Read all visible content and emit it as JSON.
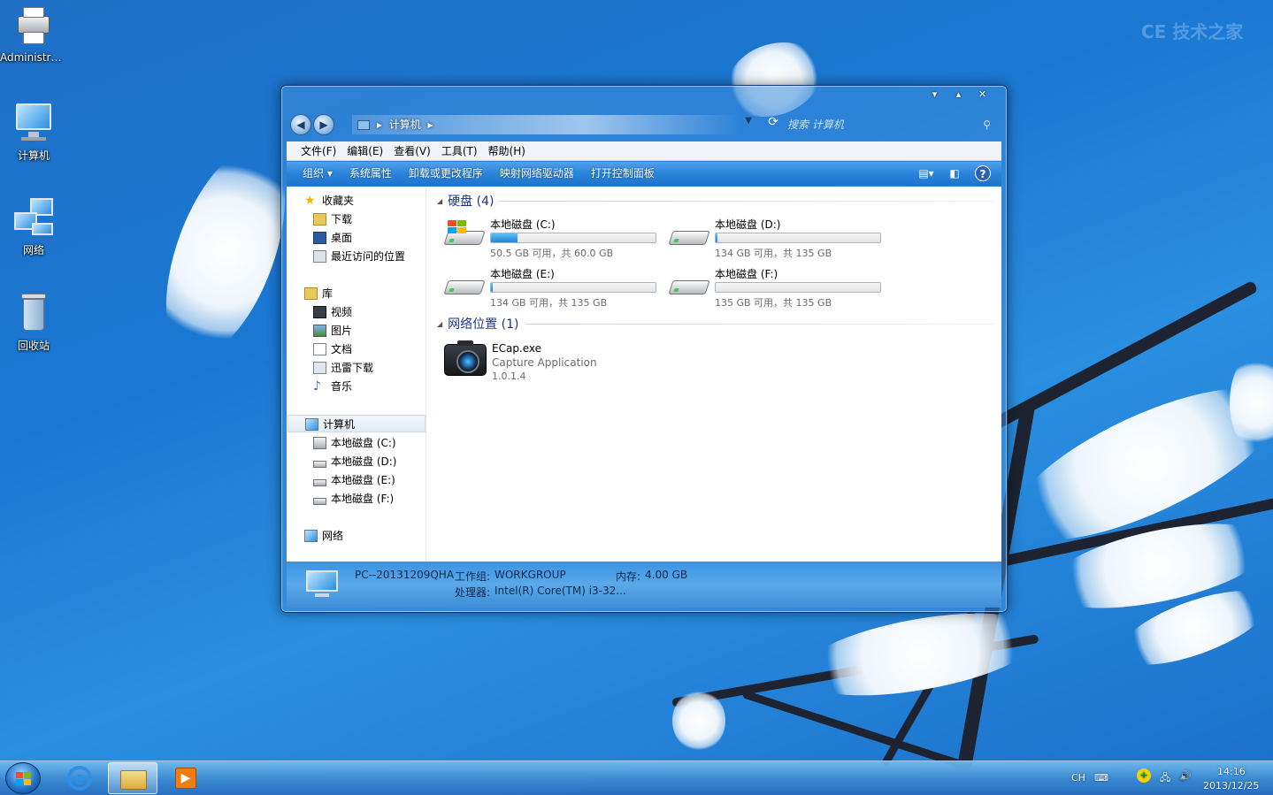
{
  "desktop": {
    "icons": [
      {
        "label": "Administra...",
        "icon": "printer-icon"
      },
      {
        "label": "计算机",
        "icon": "computer-icon"
      },
      {
        "label": "网络",
        "icon": "network-icon"
      },
      {
        "label": "回收站",
        "icon": "recycle-bin-icon"
      }
    ]
  },
  "window": {
    "controls": {
      "minimize": "▾",
      "maximize": "▴",
      "close": "✕"
    },
    "nav": {
      "back": "◀",
      "forward": "▶"
    },
    "address": {
      "path_item": "计算机",
      "separator": "▸"
    },
    "search": {
      "placeholder": "搜索 计算机",
      "icon": "⚲"
    },
    "menu": [
      "文件(F)",
      "编辑(E)",
      "查看(V)",
      "工具(T)",
      "帮助(H)"
    ],
    "toolbar": {
      "organize": "组织 ▾",
      "system_properties": "系统属性",
      "uninstall": "卸载或更改程序",
      "map_drive": "映射网络驱动器",
      "control_panel": "打开控制面板",
      "help": "?"
    },
    "nav_pane": {
      "favorites": "收藏夹",
      "downloads": "下载",
      "desktop": "桌面",
      "recent": "最近访问的位置",
      "libraries": "库",
      "videos": "视频",
      "pictures": "图片",
      "documents": "文档",
      "thunder": "迅雷下载",
      "music": "音乐",
      "computer": "计算机",
      "drive_c": "本地磁盘 (C:)",
      "drive_d": "本地磁盘 (D:)",
      "drive_e": "本地磁盘 (E:)",
      "drive_f": "本地磁盘 (F:)",
      "network": "网络"
    },
    "groups": {
      "hdd": "硬盘 (4)",
      "network": "网络位置 (1)"
    },
    "drives": [
      {
        "name": "本地磁盘 (C:)",
        "info": "50.5 GB 可用，共 60.0 GB",
        "used_fraction": 0.16
      },
      {
        "name": "本地磁盘 (D:)",
        "info": "134 GB 可用，共 135 GB",
        "used_fraction": 0.01
      },
      {
        "name": "本地磁盘 (E:)",
        "info": "134 GB 可用，共 135 GB",
        "used_fraction": 0.01
      },
      {
        "name": "本地磁盘 (F:)",
        "info": "135 GB 可用，共 135 GB",
        "used_fraction": 0.0
      }
    ],
    "network_item": {
      "name": "ECap.exe",
      "description": "Capture Application",
      "version": "1.0.1.4"
    },
    "details": {
      "pc_name": "PC--20131209QHA",
      "workgroup_label": "工作组:",
      "workgroup": "WORKGROUP",
      "memory_label": "内存:",
      "memory": "4.00 GB",
      "cpu_label": "处理器:",
      "cpu": "Intel(R) Core(TM) i3-32..."
    }
  },
  "taskbar": {
    "tray": {
      "lang": "CH",
      "time": "14:16",
      "date": "2013/12/25"
    }
  },
  "watermark": "CE 技术之家"
}
